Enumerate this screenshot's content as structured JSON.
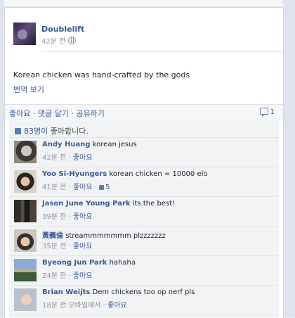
{
  "post": {
    "author": "Doublelift",
    "time": "42분 전",
    "privacy_icon": "globe-icon",
    "text": "Korean chicken was hand-crafted by the gods",
    "translate": "번역 보기"
  },
  "actions": {
    "like": "좋아요",
    "sep": " · ",
    "comment": "댓글 달기",
    "share": "공유하기",
    "comment_count": "1"
  },
  "likes": {
    "count": "83명이",
    "suffix": " 좋아합니다."
  },
  "comments": [
    {
      "name": "Andy Huang",
      "text": "korean jesus",
      "time": "42분 전",
      "like": "좋아요",
      "like_count": ""
    },
    {
      "name": "Yoo Si-Hyungers",
      "text": "korean chicken = 10000 elo",
      "time": "41분 전",
      "like": "좋아요",
      "like_count": "5"
    },
    {
      "name": "Jason June Young Park",
      "text": "its the best!",
      "time": "39분 전",
      "like": "좋아요",
      "like_count": ""
    },
    {
      "name": "黃義倫",
      "text": "streammmmmmm plzzzzzzz",
      "time": "35분 전",
      "like": "좋아요",
      "like_count": ""
    },
    {
      "name": "Byeong Jun Park",
      "text": "hahaha",
      "time": "24분 전",
      "like": "좋아요",
      "like_count": ""
    },
    {
      "name": "Brian Weijts",
      "text": "Dem chickens too op nerf pls",
      "time": "18분 전 모바일에서",
      "like": "좋아요",
      "like_count": ""
    }
  ],
  "colors": {
    "link": "#3b5998",
    "meta": "#90949c",
    "ufi_bg": "#f2f3f5"
  }
}
